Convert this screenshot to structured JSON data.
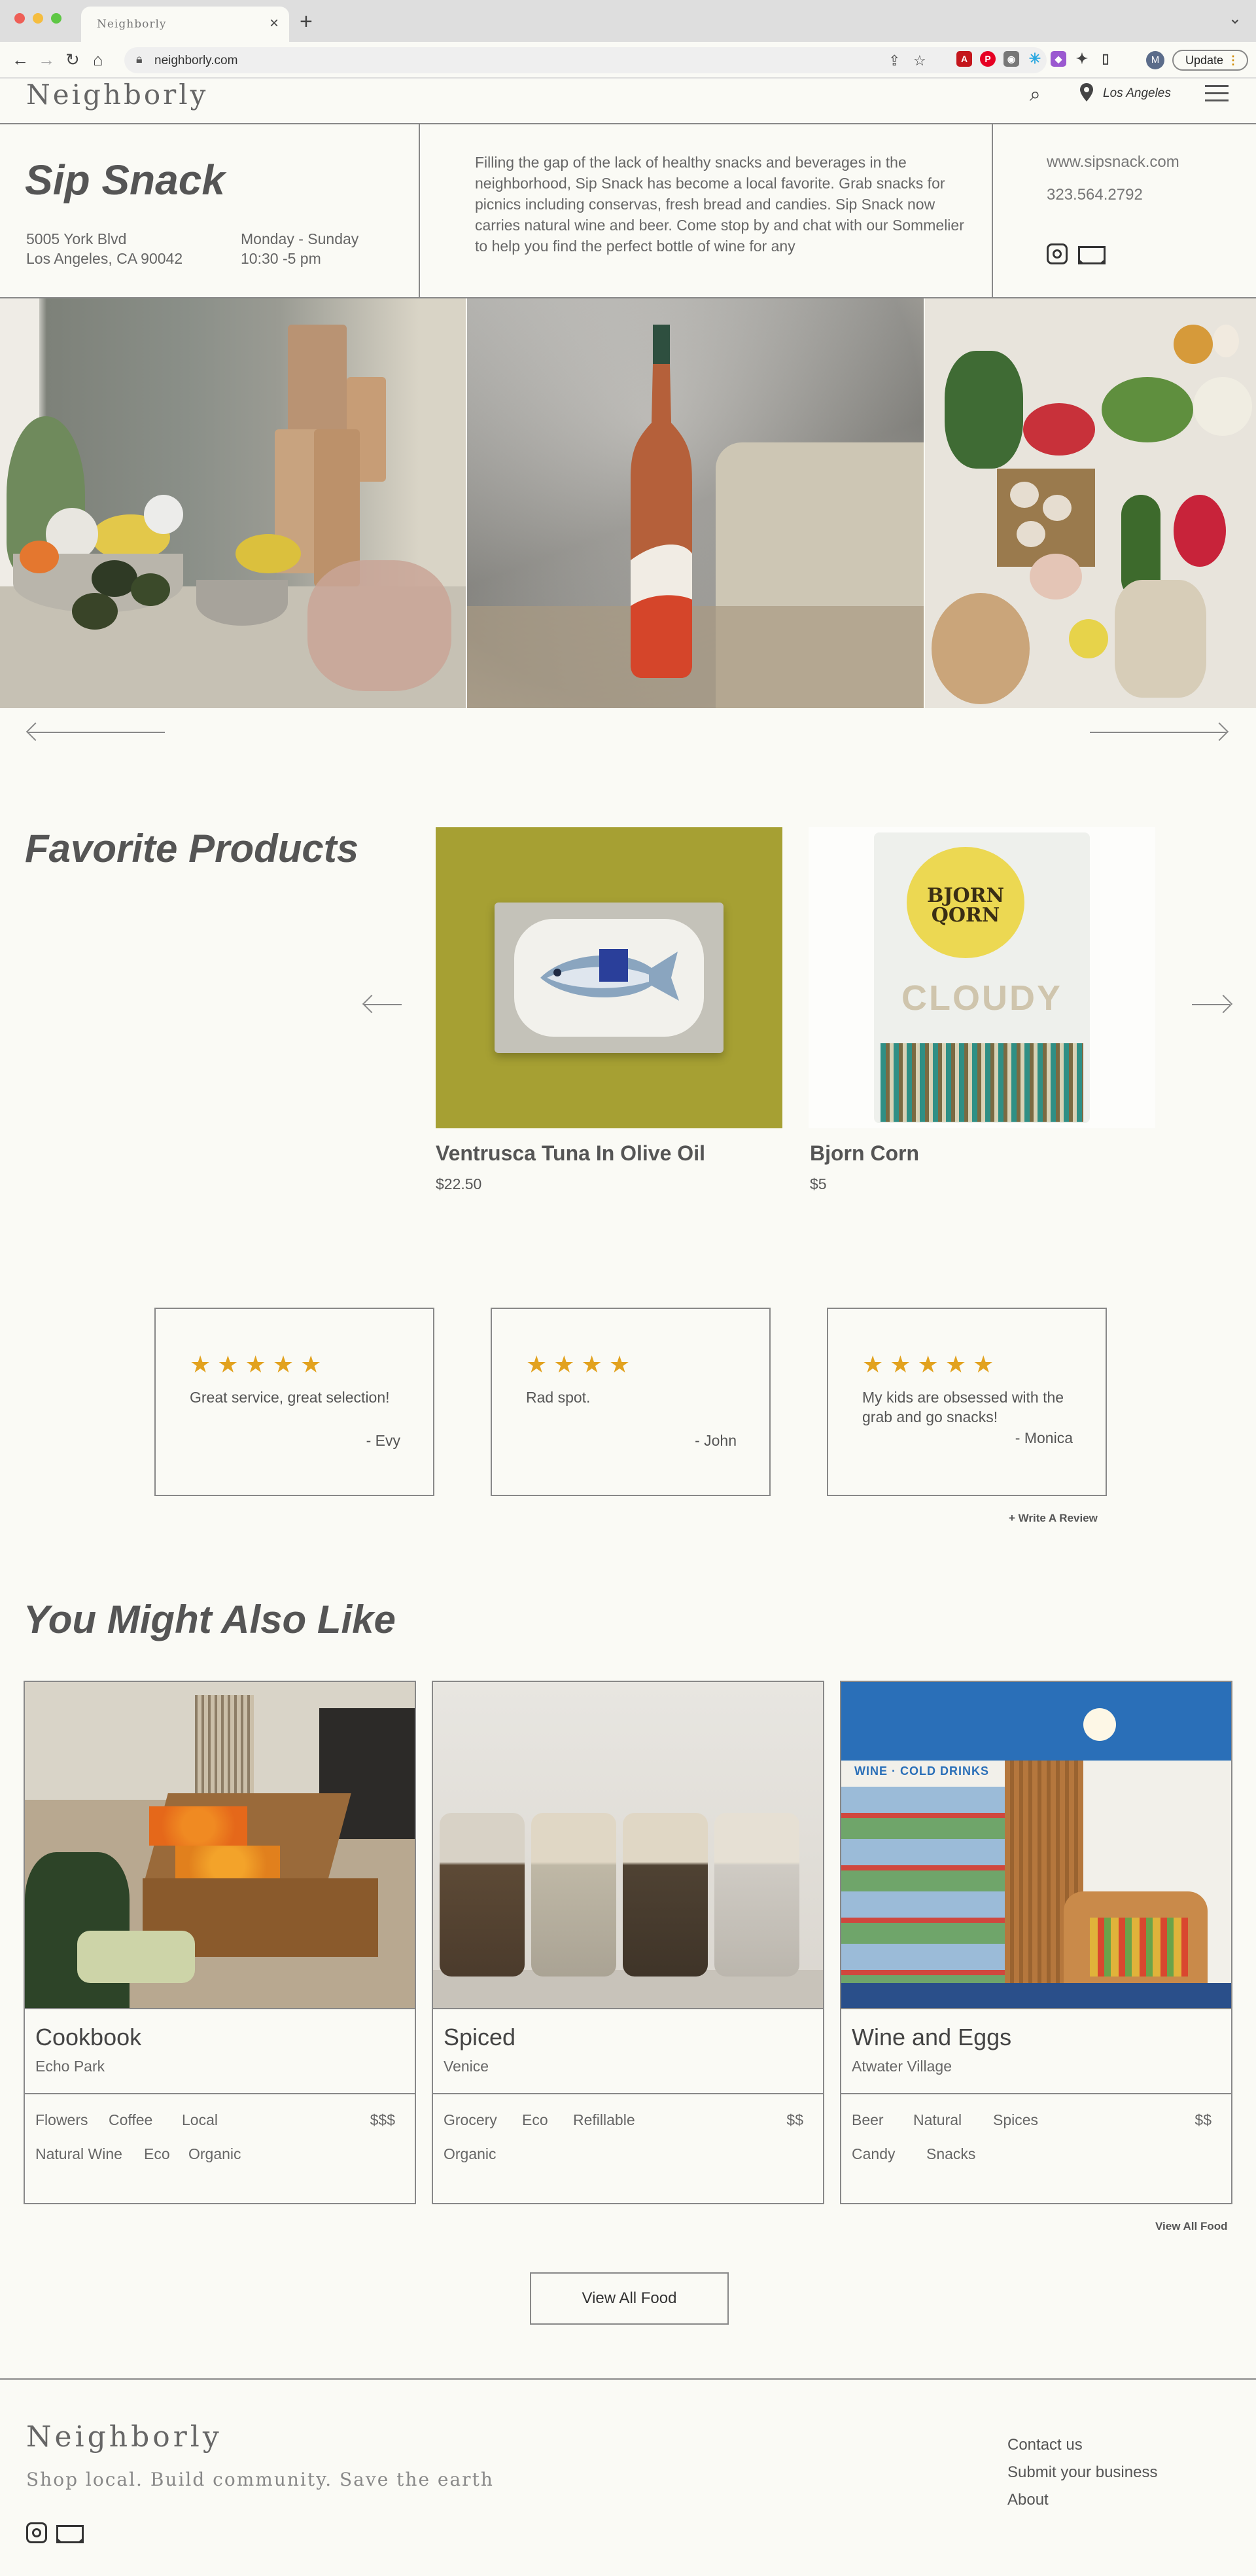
{
  "browser": {
    "tab_title": "Neighborly",
    "url": "neighborly.com",
    "update_label": "Update",
    "avatar_letter": "M"
  },
  "site": {
    "brand": "Neighborly",
    "location": "Los Angeles"
  },
  "store": {
    "name": "Sip Snack",
    "address_line1": "5005 York Blvd",
    "address_line2": "Los Angeles, CA 90042",
    "hours_days": "Monday - Sunday",
    "hours_time": "10:30 -5 pm",
    "description": "Filling the gap of the lack of healthy snacks and beverages in the neighborhood, Sip Snack has become a local favorite. Grab snacks for picnics including conservas, fresh bread and candies. Sip Snack now carries natural wine and beer. Come stop by and chat with our Sommelier to help you find the perfect bottle of wine for any",
    "website": "www.sipsnack.com",
    "phone": "323.564.2792"
  },
  "favorites": {
    "title": "Favorite Products",
    "products": [
      {
        "name": "Ventrusca Tuna In Olive Oil",
        "price": "$22.50",
        "image": "tuna-tin"
      },
      {
        "name": "Bjorn Corn",
        "price": "$5",
        "image": "popcorn-bag",
        "brand_text": "BJORN QORN",
        "art_text": "CLOUDY"
      }
    ]
  },
  "reviews": {
    "items": [
      {
        "stars": "★★★★★",
        "text": "Great service, great selection!",
        "author": "- Evy"
      },
      {
        "stars": "★★★★",
        "text": "Rad spot.",
        "author": "- John"
      },
      {
        "stars": "★★★★★",
        "text": "My kids are obsessed with the grab and go snacks!",
        "author": "- Monica"
      }
    ],
    "write_label": "+ Write A Review"
  },
  "also_like": {
    "title": "You Might Also Like",
    "cards": [
      {
        "name": "Cookbook",
        "area": "Echo Park",
        "price": "$$$",
        "tags": [
          "Flowers",
          "Coffee",
          "Local",
          "Natural Wine",
          "Eco",
          "Organic"
        ]
      },
      {
        "name": "Spiced",
        "area": "Venice",
        "price": "$$",
        "tags": [
          "Grocery",
          "Eco",
          "Refillable",
          "Organic"
        ]
      },
      {
        "name": "Wine and Eggs",
        "area": "Atwater Village",
        "price": "$$",
        "tags": [
          "Beer",
          "Natural",
          "Spices",
          "Candy",
          "Snacks"
        ],
        "sign_text": "WINE · COLD DRINKS"
      }
    ],
    "view_all_link": "View All Food",
    "view_all_button": "View All Food"
  },
  "footer": {
    "brand": "Neighborly",
    "tagline": "Shop local. Build community. Save the earth",
    "links": [
      "Contact us",
      "Submit your business",
      "About"
    ]
  },
  "colors": {
    "background": "#fafaf5",
    "text": "#555555",
    "star": "#e2a21f",
    "border": "#888888"
  }
}
